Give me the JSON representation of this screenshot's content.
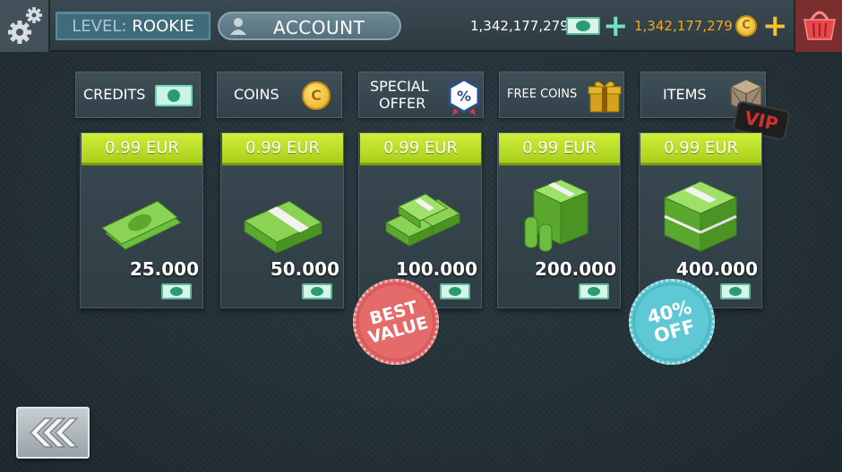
{
  "header": {
    "level_label": "LEVEL:",
    "level_value": "ROOKIE",
    "account_label": "ACCOUNT",
    "cash_amount": "1,342,177,279",
    "coin_amount": "1,342,177,279",
    "plus": "+"
  },
  "tabs": [
    {
      "label": "CREDITS"
    },
    {
      "label": "COINS"
    },
    {
      "label": "SPECIAL",
      "label2": "OFFER"
    },
    {
      "label": "FREE COINS"
    },
    {
      "label": "ITEMS"
    }
  ],
  "vip": "VIP",
  "offers": [
    {
      "price": "0.99 EUR",
      "amount": "25.000"
    },
    {
      "price": "0.99 EUR",
      "amount": "50.000"
    },
    {
      "price": "0.99 EUR",
      "amount": "100.000"
    },
    {
      "price": "0.99 EUR",
      "amount": "200.000"
    },
    {
      "price": "0.99 EUR",
      "amount": "400.000"
    }
  ],
  "badges": {
    "best_value_line1": "BEST",
    "best_value_line2": "VALUE",
    "off_line1": "40%",
    "off_line2": "OFF"
  },
  "colors": {
    "price_green": "#c3e22e",
    "coin_gold": "#f5a623",
    "best_value_red": "#e56b6b",
    "off_teal": "#5ec8d4"
  },
  "icons": [
    "gear-icon",
    "user-icon",
    "bill-icon",
    "coin-icon",
    "basket-icon",
    "percent-icon",
    "gift-icon",
    "crate-icon",
    "back-arrows-icon"
  ]
}
